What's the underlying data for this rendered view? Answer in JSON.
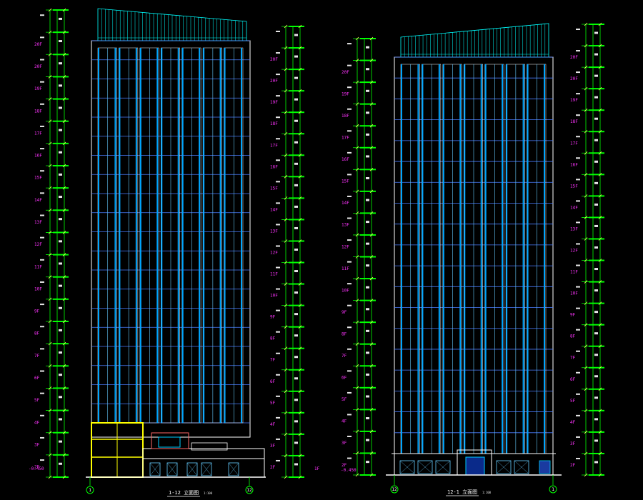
{
  "colors": {
    "background": "#000000",
    "outline": "#ffffff",
    "mullion": "#00a6ff",
    "mullion_light": "#66ccff",
    "floor_line": "#4a7dff",
    "dimension": "#00ff00",
    "dim_tick": "#ffff66",
    "crown": "#00ffff",
    "podium": "#ffff00",
    "floor_label": "#ff33ff",
    "annotation": "#e6e6e6"
  },
  "floor_labels": [
    "1F",
    "2F",
    "3F",
    "4F",
    "5F",
    "6F",
    "7F",
    "8F",
    "9F",
    "10F",
    "11F",
    "12F",
    "13F",
    "14F",
    "15F",
    "16F",
    "17F",
    "18F",
    "19F",
    "20F"
  ],
  "left_elevation": {
    "title": "1-12 立面图",
    "scale": "1:100",
    "axis_start": "1",
    "axis_end": "12",
    "bottom_level": "-0.450"
  },
  "right_elevation": {
    "title": "12-1 立面图",
    "scale": "1:100",
    "axis_start": "12",
    "axis_end": "1",
    "bottom_level": "-0.450"
  },
  "side_labels": {
    "right_of_left_dims": "1F"
  }
}
